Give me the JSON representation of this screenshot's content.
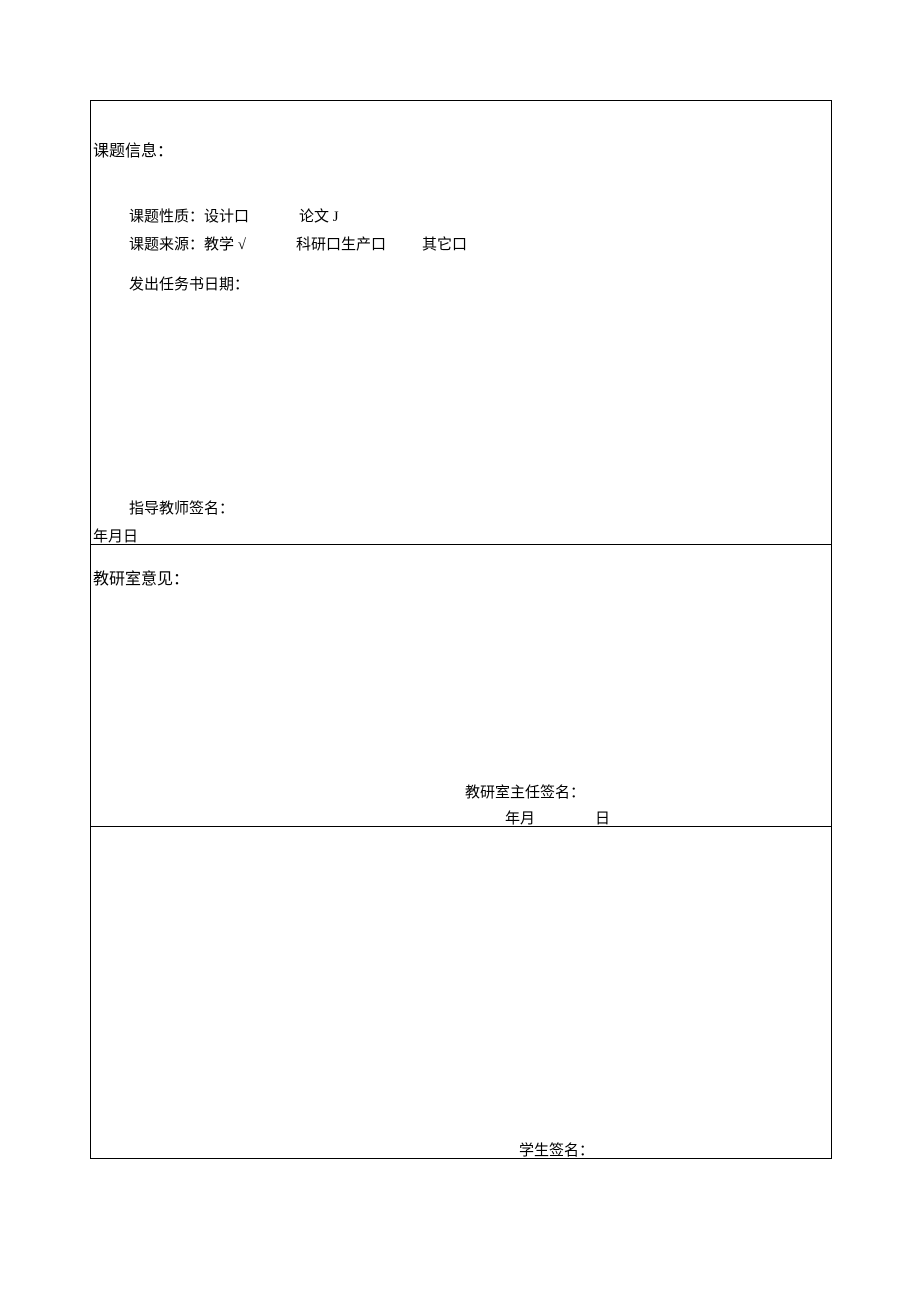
{
  "section1": {
    "header": "课题信息：",
    "nature_label": "课题性质：",
    "nature_opt1": "设计口",
    "nature_opt2": "论文 J",
    "source_label": "课题来源：",
    "source_opt1": "教学 √",
    "source_opt2": "科研口生产口",
    "source_opt3": "其它口",
    "issue_date_label": "发出任务书日期：",
    "advisor_label": "指导教师签名：",
    "ymd": "年月日"
  },
  "section2": {
    "header": "教研室意见：",
    "sign_label": "教研室主任签名：",
    "date_ym": "年月",
    "date_d": "日"
  },
  "section3": {
    "sign_label": "学生签名："
  }
}
